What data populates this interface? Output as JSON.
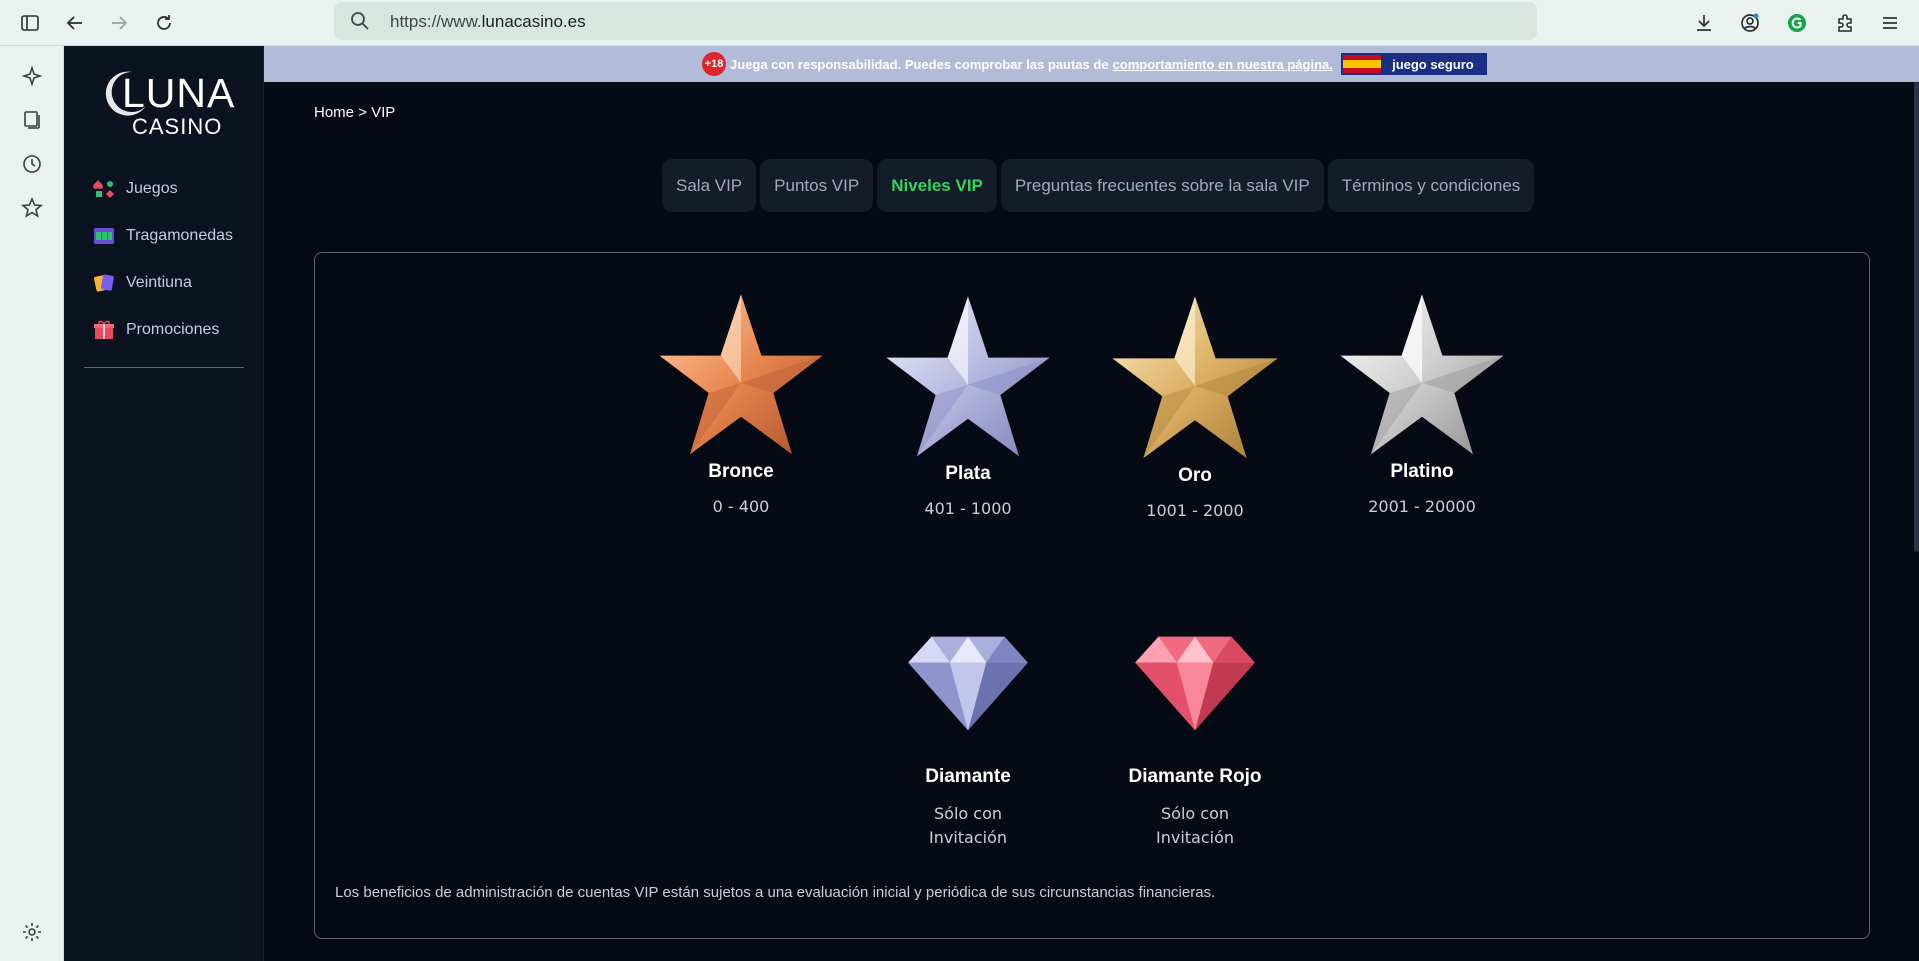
{
  "browser": {
    "url_prefix": "https://www.",
    "url_domain": "lunacasino.es"
  },
  "sidebar": {
    "logo_top": "LUNA",
    "logo_bottom": "CASINO",
    "items": [
      {
        "label": "Juegos",
        "icon": "games-icon"
      },
      {
        "label": "Tragamonedas",
        "icon": "slot-machine-icon"
      },
      {
        "label": "Veintiuna",
        "icon": "cards-icon"
      },
      {
        "label": "Promociones",
        "icon": "gift-icon"
      }
    ]
  },
  "notice": {
    "badge": "+18",
    "text": "Juega con responsabilidad. Puedes comprobar las pautas de",
    "link": "comportamiento en nuestra página.",
    "seal": "juego seguro"
  },
  "breadcrumb": "Home > VIP",
  "tabs": [
    {
      "label": "Sala VIP",
      "active": false
    },
    {
      "label": "Puntos VIP",
      "active": false
    },
    {
      "label": "Niveles VIP",
      "active": true
    },
    {
      "label": "Preguntas frecuentes sobre la sala VIP",
      "active": false
    },
    {
      "label": "Términos y condiciones",
      "active": false
    }
  ],
  "levels": [
    {
      "name": "Bronce",
      "range": "0 - 400",
      "icon": "bronze-star-icon",
      "color": "#e89a6a"
    },
    {
      "name": "Plata",
      "range": "401 - 1000",
      "icon": "silver-star-icon",
      "color": "#c6c8e8"
    },
    {
      "name": "Oro",
      "range": "1001 - 2000",
      "icon": "gold-star-icon",
      "color": "#e8c27a"
    },
    {
      "name": "Platino",
      "range": "2001 - 20000",
      "icon": "platinum-star-icon",
      "color": "#d8d8d8"
    },
    {
      "name": "Diamante",
      "range_line1": "Sólo con",
      "range_line2": "Invitación",
      "icon": "diamond-icon",
      "color": "#aab0dc"
    },
    {
      "name": "Diamante Rojo",
      "range_line1": "Sólo con",
      "range_line2": "Invitación",
      "icon": "red-diamond-icon",
      "color": "#f06a80"
    }
  ],
  "footnote": "Los beneficios de administración de cuentas VIP están sujetos a una evaluación inicial y periódica de sus circunstancias financieras."
}
